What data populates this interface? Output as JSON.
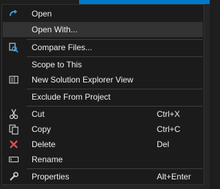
{
  "menu": {
    "items": [
      {
        "label": "Open",
        "shortcut": "",
        "icon": "open-arrow-icon"
      },
      {
        "label": "Open With...",
        "shortcut": "",
        "icon": ""
      },
      {
        "label": "Compare Files...",
        "shortcut": "",
        "icon": "compare-files-icon"
      },
      {
        "label": "Scope to This",
        "shortcut": "",
        "icon": ""
      },
      {
        "label": "New Solution Explorer View",
        "shortcut": "",
        "icon": "new-view-icon"
      },
      {
        "label": "Exclude From Project",
        "shortcut": "",
        "icon": ""
      },
      {
        "label": "Cut",
        "shortcut": "Ctrl+X",
        "icon": "scissors-icon"
      },
      {
        "label": "Copy",
        "shortcut": "Ctrl+C",
        "icon": "copy-icon"
      },
      {
        "label": "Delete",
        "shortcut": "Del",
        "icon": "delete-x-icon"
      },
      {
        "label": "Rename",
        "shortcut": "",
        "icon": "rename-icon"
      },
      {
        "label": "Properties",
        "shortcut": "Alt+Enter",
        "icon": "wrench-icon"
      }
    ]
  },
  "colors": {
    "menu_bg": "#1b1b1c",
    "highlight": "#333334",
    "accent_blue": "#3e9ede",
    "delete_red": "#e05050",
    "text": "#f1f1f1"
  }
}
